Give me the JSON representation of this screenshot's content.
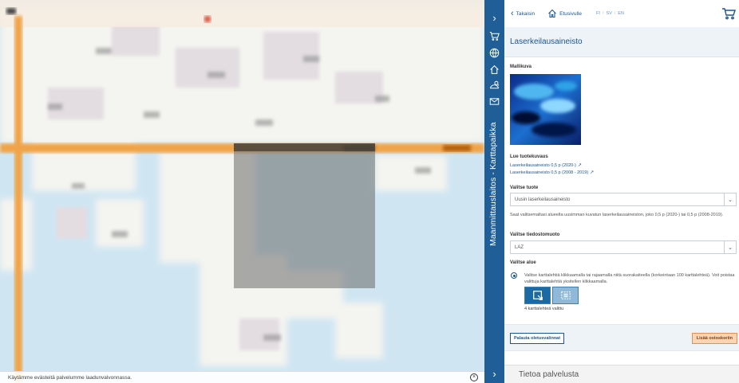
{
  "map": {
    "cookie_notice": "Käytämme evästeitä palvelumme laadunvalvonnassa.",
    "cookie_close_icon": "close-circle-icon"
  },
  "strip": {
    "title": "Maanmittauslaitos - Karttapaikka",
    "icons": [
      "chevron-right-icon",
      "cart-icon",
      "globe-icon",
      "home-icon",
      "location-search-icon",
      "mail-icon",
      "chevron-right-icon"
    ]
  },
  "panel": {
    "nav": {
      "back_label": "Takaisin",
      "home_label": "Etusivulle",
      "lang_fi": "FI",
      "lang_sv": "SV",
      "lang_en": "EN",
      "sep": "/"
    },
    "title": "Laserkeilausaineisto",
    "sample_label": "Mallikuva",
    "description_label": "Lue tuotekuvaus",
    "links": [
      "Laserkeilausaineisto 0,5 p (2020-)",
      "Laserkeilausaineisto 0,5 p (2008 - 2019)"
    ],
    "product_label": "Valitse tuote",
    "product_value": "Uusin laserkeilausaineisto",
    "product_help": "Saat valitsemaltasi alueelta uusimman kuvatun laserkeilausaineiston, joko 0,5 p (2020-) tai 0,5 p (2008-2019).",
    "format_label": "Valitse tiedostomuoto",
    "format_value": "LAZ",
    "area_label": "Valitse alue",
    "area_option": "Valitse karttalehtiä klikkaamalla tai rajaamalla niitä suorakaiteella (korkeintaan 100 karttalehteä). Voit poistaa valittuja karttalehtiä yksitellen klikkaamalla.",
    "selected_count": "4 karttalehteä valittu",
    "reset_button": "Palauta oletusvalinnat",
    "add_button": "Lisää ostoskoriin",
    "info_heading": "Tietoa palvelusta"
  },
  "colors": {
    "primary": "#1f5e96",
    "link": "#1b5591",
    "accent": "#fcd5b4",
    "road": "#f0a44a",
    "water": "#cfe6f2"
  }
}
